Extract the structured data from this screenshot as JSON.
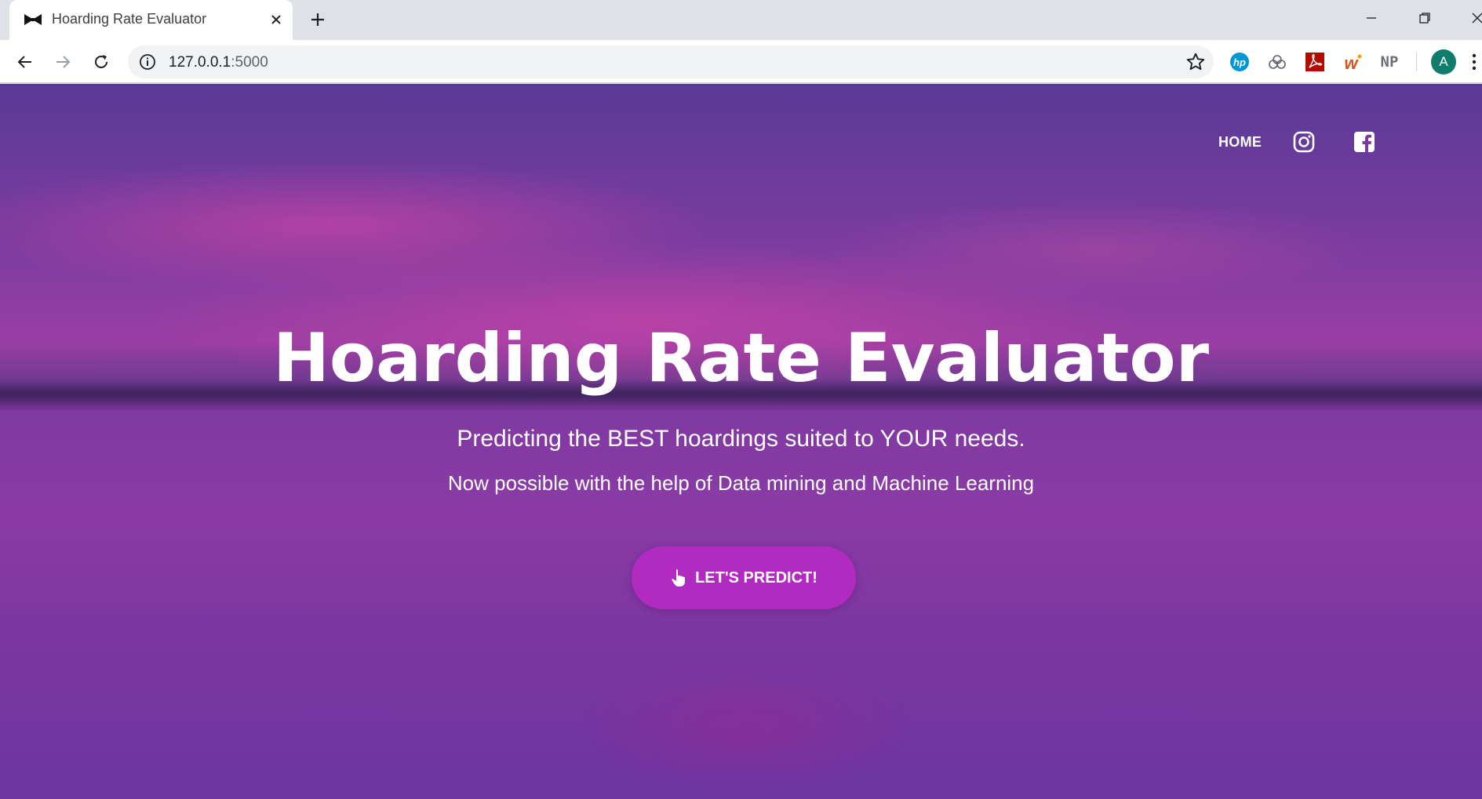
{
  "browser": {
    "tab_title": "Hoarding Rate Evaluator",
    "url_host": "127.0.0.1",
    "url_port": ":5000",
    "extensions": [
      "hp-icon",
      "cloud-extension-icon",
      "acrobat-icon",
      "w-extension-icon",
      "np-extension-icon"
    ],
    "np_label": "NP",
    "profile_initial": "A"
  },
  "nav": {
    "home_label": "HOME",
    "icons": [
      "instagram-icon",
      "facebook-icon"
    ]
  },
  "hero": {
    "title": "Hoarding Rate Evaluator",
    "subtitle": "Predicting the BEST hoardings suited to YOUR needs.",
    "tagline": "Now possible with the help of Data mining and Machine Learning",
    "cta_label": "LET'S PREDICT!",
    "cta_icon": "pointer-hand-icon"
  },
  "colors": {
    "cta_background": "#b12bc0",
    "avatar_background": "#0f7d6e",
    "hero_text": "#ffffff"
  }
}
